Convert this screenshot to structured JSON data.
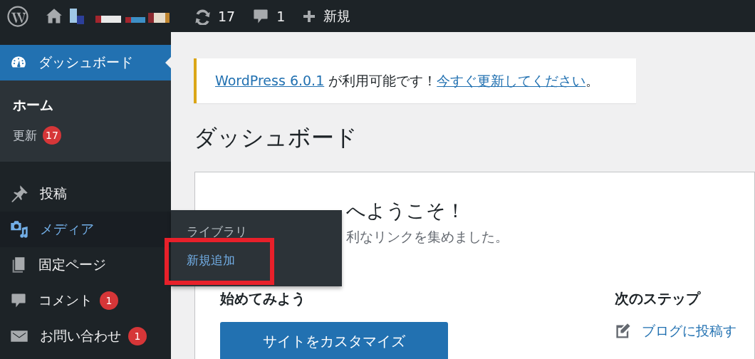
{
  "admin_bar": {
    "update_count": "17",
    "comment_count": "1",
    "new_label": "新規"
  },
  "sidebar": {
    "items": [
      {
        "label": "ダッシュボード",
        "selected": true,
        "open": false,
        "submenu": [
          {
            "label": "ホーム",
            "selected": true
          },
          {
            "label": "更新",
            "selected": false,
            "badge": "17"
          }
        ]
      },
      {
        "label": "投稿",
        "selected": false,
        "open": false
      },
      {
        "label": "メディア",
        "selected": false,
        "open": true,
        "flyout": [
          {
            "label": "ライブラリ",
            "selected": false,
            "boxed": false
          },
          {
            "label": "新規追加",
            "selected": true,
            "boxed": true
          }
        ]
      },
      {
        "label": "固定ページ",
        "selected": false,
        "open": false
      },
      {
        "label": "コメント",
        "selected": false,
        "open": false,
        "badge": "1"
      },
      {
        "label": "お問い合わせ",
        "selected": false,
        "open": false,
        "badge": "1"
      }
    ]
  },
  "notice": {
    "link": "WordPress 6.0.1",
    "text": " が利用可能です！",
    "action": "今すぐ更新してください",
    "end": "。"
  },
  "page_title": "ダッシュボード",
  "welcome": {
    "title": "へようこそ！",
    "subtitle": "利なリンクを集めました。",
    "columns": [
      {
        "heading": "始めてみよう",
        "button": "サイトをカスタマイズ"
      },
      {
        "heading": "次のステップ",
        "link": "ブログに投稿す"
      }
    ]
  }
}
